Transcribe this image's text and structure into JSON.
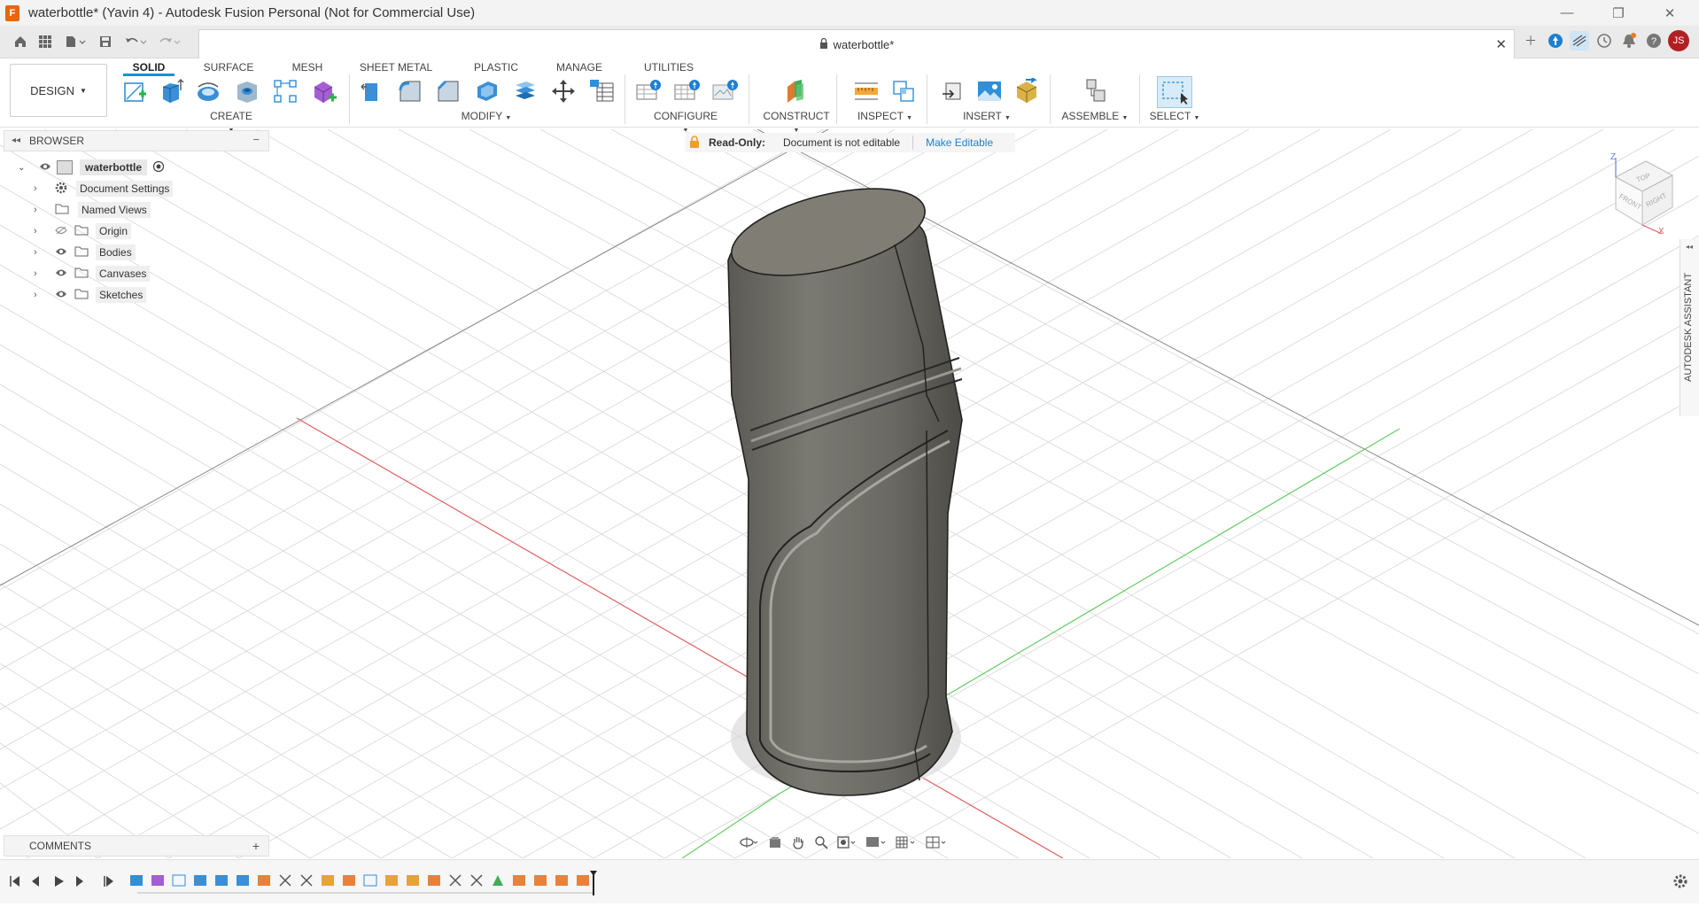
{
  "window": {
    "title": "waterbottle* (Yavin 4) - Autodesk Fusion Personal (Not for Commercial Use)"
  },
  "tabbar": {
    "doc_tab_label": "waterbottle*",
    "user_initials": "JS"
  },
  "workspace": {
    "label": "DESIGN"
  },
  "ribbon": {
    "tabs": [
      "SOLID",
      "SURFACE",
      "MESH",
      "SHEET METAL",
      "PLASTIC",
      "MANAGE",
      "UTILITIES"
    ],
    "groups": {
      "create": "CREATE",
      "modify": "MODIFY",
      "configure": "CONFIGURE",
      "construct": "CONSTRUCT",
      "inspect": "INSPECT",
      "insert": "INSERT",
      "assemble": "ASSEMBLE",
      "select": "SELECT"
    }
  },
  "browser": {
    "title": "BROWSER",
    "root": "waterbottle",
    "items": [
      "Document Settings",
      "Named Views",
      "Origin",
      "Bodies",
      "Canvases",
      "Sketches"
    ]
  },
  "readonly_bar": {
    "label": "Read-Only:",
    "message": "Document is not editable",
    "action": "Make Editable"
  },
  "comments": {
    "title": "COMMENTS"
  },
  "assistant": {
    "label": "AUTODESK ASSISTANT"
  },
  "viewcube": {
    "top": "TOP",
    "front": "FRONT",
    "right": "RIGHT",
    "axis_z": "Z",
    "axis_x": "X"
  },
  "colors": {
    "accent": "#0696d7",
    "x_axis": "#e06060",
    "y_axis": "#66cc66",
    "body": "#6b6a64"
  }
}
